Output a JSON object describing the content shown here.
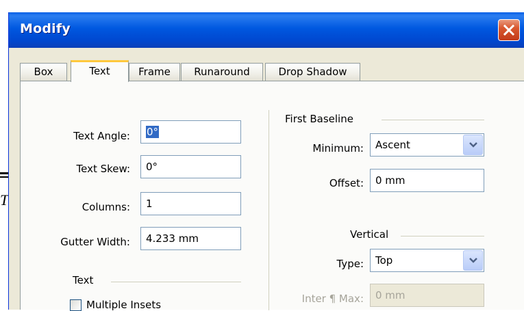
{
  "dialog": {
    "title": "Modify"
  },
  "tabs": [
    {
      "label": "Box",
      "active": false
    },
    {
      "label": "Text",
      "active": true
    },
    {
      "label": "Frame",
      "active": false
    },
    {
      "label": "Runaround",
      "active": false
    },
    {
      "label": "Drop Shadow",
      "active": false
    }
  ],
  "left": {
    "text_angle": {
      "label": "Text Angle:",
      "value": "0°"
    },
    "text_skew": {
      "label": "Text Skew:",
      "value": "0°"
    },
    "columns": {
      "label": "Columns:",
      "value": "1"
    },
    "gutter_width": {
      "label": "Gutter Width:",
      "value": "4.233 mm"
    },
    "text_group": {
      "label": "Text"
    },
    "multiple_insets": {
      "label": "Multiple Insets",
      "checked": false
    }
  },
  "right": {
    "first_baseline": {
      "label": "First Baseline"
    },
    "minimum": {
      "label": "Minimum:",
      "value": "Ascent"
    },
    "offset": {
      "label": "Offset:",
      "value": "0 mm"
    },
    "vertical": {
      "label": "Vertical"
    },
    "type": {
      "label": "Type:",
      "value": "Top"
    },
    "inter_max": {
      "label": "Inter ¶ Max:",
      "value": "0 mm",
      "disabled": true
    }
  },
  "background": {
    "partial_glyph": "T"
  },
  "colors": {
    "titlebar": "#0058e0",
    "dialog_bg": "#ece9d8",
    "active_tab_accent": "#ffc83c",
    "close_button": "#d9582f",
    "selection": "#316ac5"
  }
}
